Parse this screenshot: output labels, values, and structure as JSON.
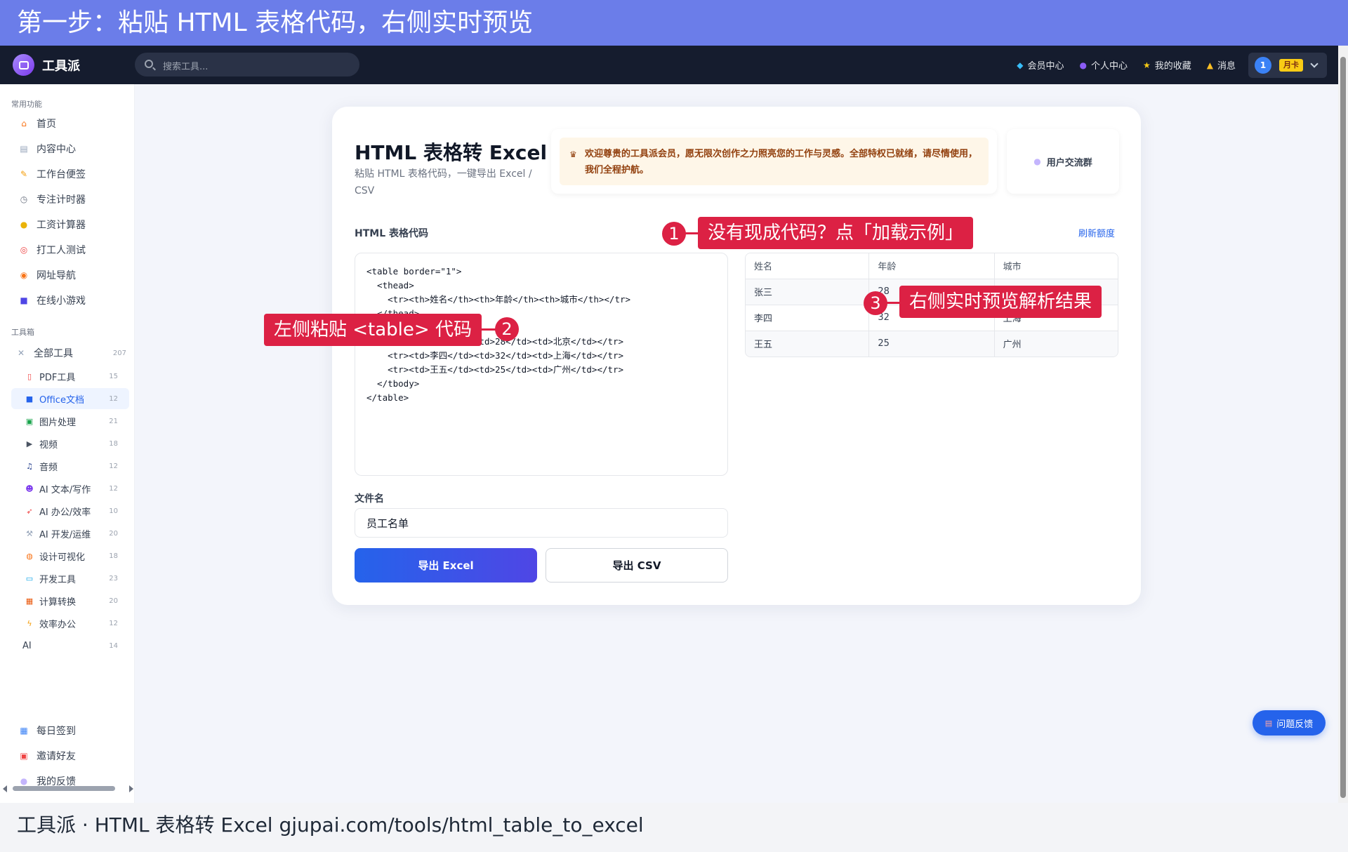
{
  "banner": "第一步：粘贴 HTML 表格代码，右侧实时预览",
  "caption": "工具派 · HTML 表格转 Excel gjupai.com/tools/html_table_to_excel",
  "navbar": {
    "brand": "工具派",
    "search_placeholder": "搜索工具...",
    "links": [
      {
        "label": "会员中心",
        "icon": "diamond-icon"
      },
      {
        "label": "个人中心",
        "icon": "user-icon"
      },
      {
        "label": "我的收藏",
        "icon": "star-icon"
      },
      {
        "label": "消息",
        "icon": "bell-icon"
      }
    ],
    "avatar_text": "1",
    "badge": "月卡"
  },
  "sidebar": {
    "section_common": "常用功能",
    "common": [
      "首页",
      "内容中心",
      "工作台便签",
      "专注计时器",
      "工资计算器",
      "打工人测试",
      "网址导航",
      "在线小游戏"
    ],
    "section_tools": "工具箱",
    "all_tools": {
      "label": "全部工具",
      "count": "207"
    },
    "tools": [
      {
        "label": "PDF工具",
        "count": "15"
      },
      {
        "label": "Office文档",
        "count": "12"
      },
      {
        "label": "图片处理",
        "count": "21"
      },
      {
        "label": "视频",
        "count": "18"
      },
      {
        "label": "音频",
        "count": "12"
      },
      {
        "label": "AI 文本/写作",
        "count": "12"
      },
      {
        "label": "AI 办公/效率",
        "count": "10"
      },
      {
        "label": "AI 开发/运维",
        "count": "20"
      },
      {
        "label": "设计可视化",
        "count": "18"
      },
      {
        "label": "开发工具",
        "count": "23"
      },
      {
        "label": "计算转换",
        "count": "20"
      },
      {
        "label": "效率办公",
        "count": "12"
      },
      {
        "label": "AI",
        "count": "14"
      }
    ],
    "bottom": [
      "每日签到",
      "邀请好友",
      "我的反馈"
    ]
  },
  "main": {
    "title": "HTML 表格转 Excel",
    "subtitle": "粘贴 HTML 表格代码，一键导出 Excel / CSV",
    "notice": "欢迎尊贵的工具派会员，愿无限次创作之力照亮您的工作与灵感。全部特权已就绪，请尽情使用，我们全程护航。",
    "group_button": "用户交流群",
    "code_label": "HTML 表格代码",
    "refresh": "刷新额度",
    "code": "<table border=\"1\">\n  <thead>\n    <tr><th>姓名</th><th>年龄</th><th>城市</th></tr>\n  </thead>\n  <tbody>\n    <tr><td>张三</td><td>28</td><td>北京</td></tr>\n    <tr><td>李四</td><td>32</td><td>上海</td></tr>\n    <tr><td>王五</td><td>25</td><td>广州</td></tr>\n  </tbody>\n</table>",
    "preview": {
      "headers": [
        "姓名",
        "年龄",
        "城市"
      ],
      "rows": [
        [
          "张三",
          "28",
          "北京"
        ],
        [
          "李四",
          "32",
          "上海"
        ],
        [
          "王五",
          "25",
          "广州"
        ]
      ]
    },
    "file_label": "文件名",
    "file_value": "员工名单",
    "export_excel": "导出 Excel",
    "export_csv": "导出 CSV"
  },
  "annotations": {
    "a1": {
      "num": "1",
      "text": "没有现成代码？点「加载示例」"
    },
    "a2": {
      "num": "2",
      "text": "左侧粘贴 <table> 代码"
    },
    "a3": {
      "num": "3",
      "text": "右侧实时预览解析结果"
    }
  },
  "feedback": "问题反馈",
  "colors": {
    "accent": "#2563eb",
    "annotation": "#dc2144",
    "banner": "#6b7de9",
    "navbar": "#151c2e"
  }
}
